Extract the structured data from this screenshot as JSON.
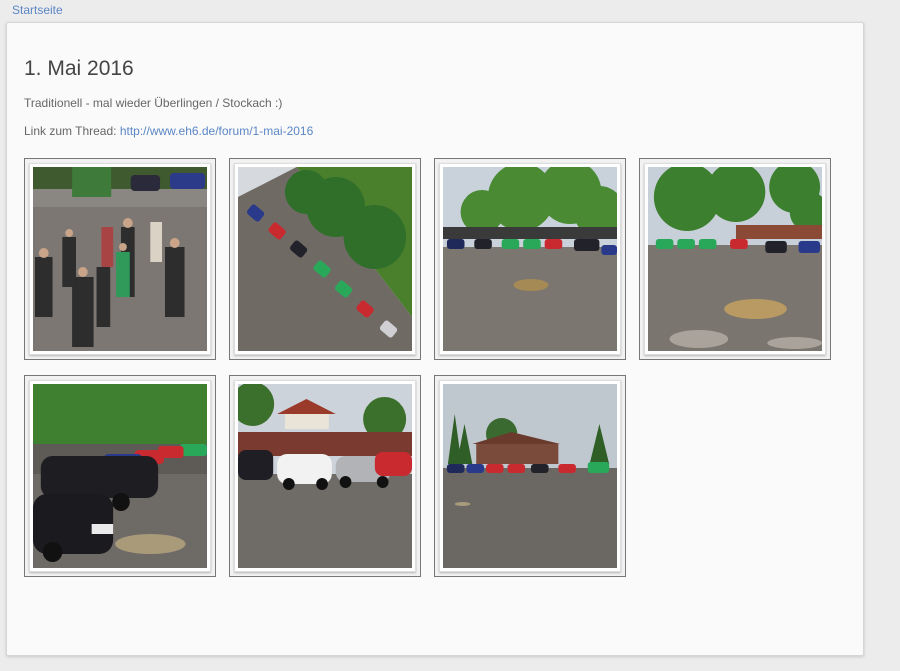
{
  "breadcrumb": {
    "home_label": "Startseite"
  },
  "album": {
    "title": "1. Mai 2016",
    "description": "Traditionell - mal wieder Überlingen / Stockach :)",
    "thread_prefix": "Link zum Thread: ",
    "thread_link": "http://www.eh6.de/forum/1-mai-2016"
  },
  "photos": [
    {
      "name": "photo-1",
      "scene": "crowd"
    },
    {
      "name": "photo-2",
      "scene": "tilted-lot"
    },
    {
      "name": "photo-3",
      "scene": "lot-trees"
    },
    {
      "name": "photo-4",
      "scene": "lot-puddles"
    },
    {
      "name": "photo-5",
      "scene": "closeup-cars"
    },
    {
      "name": "photo-6",
      "scene": "fence-cars"
    },
    {
      "name": "photo-7",
      "scene": "lot-building"
    }
  ]
}
